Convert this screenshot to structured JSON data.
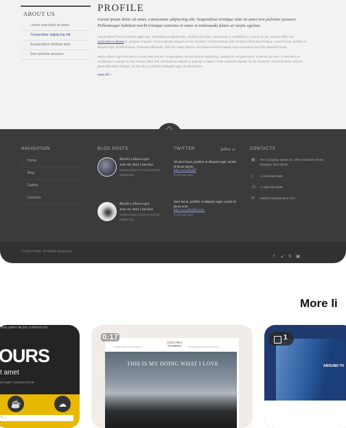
{
  "preview": {
    "sidebar": {
      "heading": "ABOUT US",
      "items": [
        {
          "label": "Lorem sum dolor sit amet"
        },
        {
          "label": "Consectetur adipiscing elit"
        },
        {
          "label": "Suspendisse tristique ame"
        },
        {
          "label": "Sem pulvinar posuere"
        }
      ]
    },
    "content": {
      "title": "PROFILE",
      "intro": "Lorem ipsum dolor sit amet, consectetur adipiscing elit. Suspendisse tristique ante sit amet sem pulvinar posuere. Pellentesque habitant morbi tristique senectus et netus et malesuada fames ac turpis egestas.",
      "para1_before": "Suspendisse rhoncus facilisis adipiscing. Vestibulum eu ligula lorem. Vivamus orci sem, consectetur ut vestibulum a, semper ac dui. Aenean tellus nisl,",
      "para1_link": "commodo eu aliquet",
      "para1_after": "ut, pulvinar ut sapien. Proin vulputate aliquam mi nec hendrerit. Sed fermentum velit vel ipsum bibendum tristique. Ut sem lacus, porttitor et aliquam eget, iaculis id lacus. Praesent sollicitudin, nibh nec mattis lobortis, dui massa eleifend magna, eget consequat risus felis dignissim ligula.",
      "para2": "Morbi a libero eget erat auctor cursus vitae id tortor. Suspendisse rhoncus facilisis adipiscing. Vestibulum eu ligula lorem. Vivamus orci sem, consectetur ut vestibulum a, semper ac dui. Aenean tellus nisl, commodo eu aliquet ut, pulvinar ut sapien. Proin vulputate aliquam mi nec hendrerit. Sed fermentum velit vel ipsum bibendum tristique. Ut sem lacus, porttitor et aliquam eget, iaculis id lacus.",
      "view_all": "view all +"
    },
    "footer": {
      "navigation": {
        "heading": "NAVIGATION",
        "items": [
          {
            "label": "Home"
          },
          {
            "label": "Blog"
          },
          {
            "label": "Gallery"
          },
          {
            "label": "Contacts"
          }
        ]
      },
      "blog": {
        "heading": "BLOG POSTS",
        "posts": [
          {
            "title": "Morbi a libero eget",
            "date": "June 15, 2012 | Joe Doe",
            "desc": "Suspendisse rhoncus facilisis adipiscing."
          },
          {
            "title": "Morbi a libero eget",
            "date": "June 15, 2012 | Joe Doe",
            "desc": "Suspendisse rhoncus facilisis adipiscing."
          }
        ]
      },
      "twitter": {
        "heading": "TWITTER",
        "follow": "follow",
        "tweets": [
          {
            "text": "Sit sem lacus, porttitor et aliquam eget, iaculis id lacus ipsum.",
            "link": "http://t.co/f3lxRT",
            "ago": "8 minutes ago"
          },
          {
            "text": "Sem lacus, porttitor et aliquam eget, iaculis id lacus eros.",
            "link": "http://t.co/f3lxRTerwnw",
            "ago": "8 minutes ago"
          }
        ]
      },
      "contacts": {
        "heading": "CONTACTS",
        "address": "The Company Name Inc. 8901 Marmora Road, Glasgow, D04 89GR.",
        "phone": "+1 800 559 6580",
        "fax": "+1 800 603 6035",
        "email": "mail@companyname.com"
      },
      "copyright": "© 2012 KING. All Rights Reserved",
      "social_icons": [
        "facebook-icon",
        "twitter-icon",
        "skype-icon",
        "youtube-icon"
      ]
    }
  },
  "more_link": "More li",
  "cards": [
    {
      "nav": "GALLERY   BLOG   CONTACTS",
      "big": "OURS",
      "sub": "t amet",
      "mini": "SIT AMET CONSECTETUR",
      "bar": "/ ..."
    },
    {
      "duration": "0:17",
      "site_logo": "GIACOMO VESPRINI",
      "menu_left": "HOME   WORK   BLOG   ABOUT",
      "menu_right": "BLOG   PRESS   SHOP   CONTACT",
      "headline": "THIS IS MY DOING WHAT I LOVE"
    },
    {
      "badge_count": "1",
      "caption": "AROUND TH"
    }
  ]
}
